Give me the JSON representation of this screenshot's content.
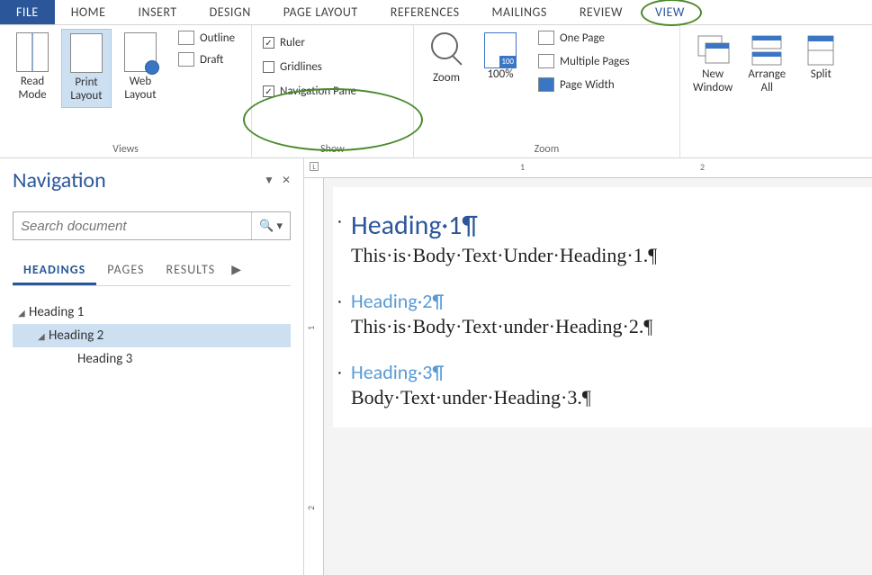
{
  "tabs": {
    "file": "FILE",
    "home": "HOME",
    "insert": "INSERT",
    "design": "DESIGN",
    "page_layout": "PAGE LAYOUT",
    "references": "REFERENCES",
    "mailings": "MAILINGS",
    "review": "REVIEW",
    "view": "VIEW"
  },
  "ribbon": {
    "views": {
      "label": "Views",
      "read_mode": "Read\nMode",
      "print_layout": "Print\nLayout",
      "web_layout": "Web\nLayout",
      "outline": "Outline",
      "draft": "Draft"
    },
    "show": {
      "label": "Show",
      "ruler": "Ruler",
      "gridlines": "Gridlines",
      "navigation_pane": "Navigation Pane"
    },
    "zoom": {
      "label": "Zoom",
      "zoom": "Zoom",
      "hundred": "100%",
      "one_page": "One Page",
      "multiple_pages": "Multiple Pages",
      "page_width": "Page Width"
    },
    "window": {
      "new_window": "New\nWindow",
      "arrange_all": "Arrange\nAll",
      "split": "Split"
    }
  },
  "nav": {
    "title": "Navigation",
    "search_placeholder": "Search document",
    "tabs": {
      "headings": "HEADINGS",
      "pages": "PAGES",
      "results": "RESULTS"
    },
    "tree": {
      "h1": "Heading 1",
      "h2": "Heading 2",
      "h3": "Heading 3"
    }
  },
  "ruler": {
    "t1": "1",
    "t2": "2"
  },
  "vruler": {
    "t1": "1",
    "t2": "2"
  },
  "doc": {
    "h1": "Heading·1¶",
    "b1": "This·is·Body·Text·Under·Heading·1.¶",
    "h2": "Heading·2¶",
    "b2": "This·is·Body·Text·under·Heading·2.¶",
    "h3": "Heading·3¶",
    "b3": "Body·Text·under·Heading·3.¶"
  }
}
